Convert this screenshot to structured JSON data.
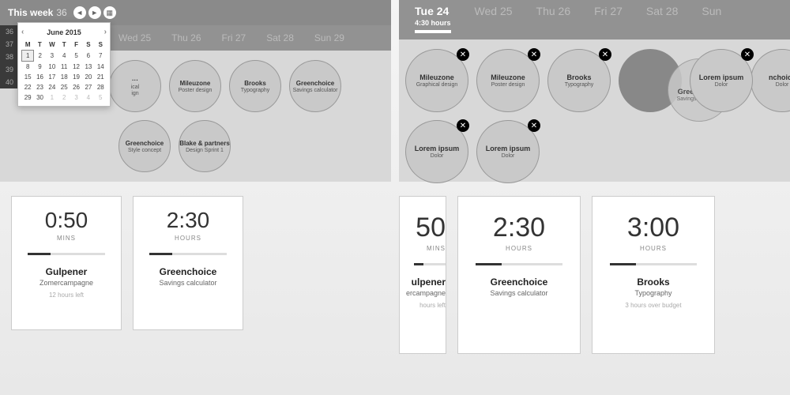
{
  "left": {
    "header": {
      "label": "This week",
      "num": "36"
    },
    "days": [
      "Wed 25",
      "Thu 26",
      "Fri 27",
      "Sat 28",
      "Sun 29"
    ],
    "weeknums": [
      "36",
      "37",
      "38",
      "39",
      "40"
    ],
    "bubbles": [
      {
        "t": "Mileuzone",
        "s": "Poster design"
      },
      {
        "t": "Brooks",
        "s": "Typography"
      },
      {
        "t": "Greenchoice",
        "s": "Savings calculator"
      },
      {
        "t": "Greenchoice",
        "s": "Style concept"
      },
      {
        "t": "Blake & partners",
        "s": "Design Sprint 1"
      }
    ],
    "cards": [
      {
        "time": "0:50",
        "unit": "MINS",
        "pname": "Gulpener",
        "pdesc": "Zomercampagne",
        "meta": "12 hours left"
      },
      {
        "time": "2:30",
        "unit": "HOURS",
        "pname": "Greenchoice",
        "pdesc": "Savings calculator",
        "meta": ""
      }
    ],
    "calendar": {
      "title": "June 2015",
      "dow": [
        "M",
        "T",
        "W",
        "T",
        "F",
        "S",
        "S"
      ],
      "rows": [
        [
          "1",
          "2",
          "3",
          "4",
          "5",
          "6",
          "7"
        ],
        [
          "8",
          "9",
          "10",
          "11",
          "12",
          "13",
          "14"
        ],
        [
          "15",
          "16",
          "17",
          "18",
          "19",
          "20",
          "21"
        ],
        [
          "22",
          "23",
          "24",
          "25",
          "26",
          "27",
          "28"
        ],
        [
          "29",
          "30",
          "1",
          "2",
          "3",
          "4",
          "5"
        ]
      ],
      "selected": "1"
    }
  },
  "right": {
    "days": [
      {
        "lbl": "Tue 24",
        "sub": "4:30 hours",
        "active": true
      },
      {
        "lbl": "Wed 25"
      },
      {
        "lbl": "Thu 26"
      },
      {
        "lbl": "Fri 27"
      },
      {
        "lbl": "Sat 28"
      },
      {
        "lbl": "Sun"
      }
    ],
    "bubbles": [
      {
        "t": "Mileuzone",
        "s": "Graphical design",
        "x": true
      },
      {
        "t": "Mileuzone",
        "s": "Poster design",
        "x": true
      },
      {
        "t": "Brooks",
        "s": "Typography",
        "x": true
      },
      {
        "drag": true
      },
      {
        "t": "Lorem ipsum",
        "s": "Dolor",
        "x": true
      },
      {
        "t": "Lorem ipsum",
        "s": "Dolor",
        "x": true
      },
      {
        "t": "Lorem ipsum",
        "s": "Dolor",
        "x": true
      }
    ],
    "ghost": {
      "t": "Greenchoice",
      "s": "Savings calculator"
    },
    "ghost2": {
      "t": "nchoice",
      "s": "Dolor"
    },
    "cards": [
      {
        "time": "50",
        "unit": "MINS",
        "pname": "ulpener",
        "pdesc": "ercampagne",
        "meta": "hours left",
        "cut": true
      },
      {
        "time": "2:30",
        "unit": "HOURS",
        "pname": "Greenchoice",
        "pdesc": "Savings calculator",
        "meta": ""
      },
      {
        "time": "3:00",
        "unit": "HOURS",
        "pname": "Brooks",
        "pdesc": "Typography",
        "meta": "3 hours over budget"
      }
    ]
  }
}
